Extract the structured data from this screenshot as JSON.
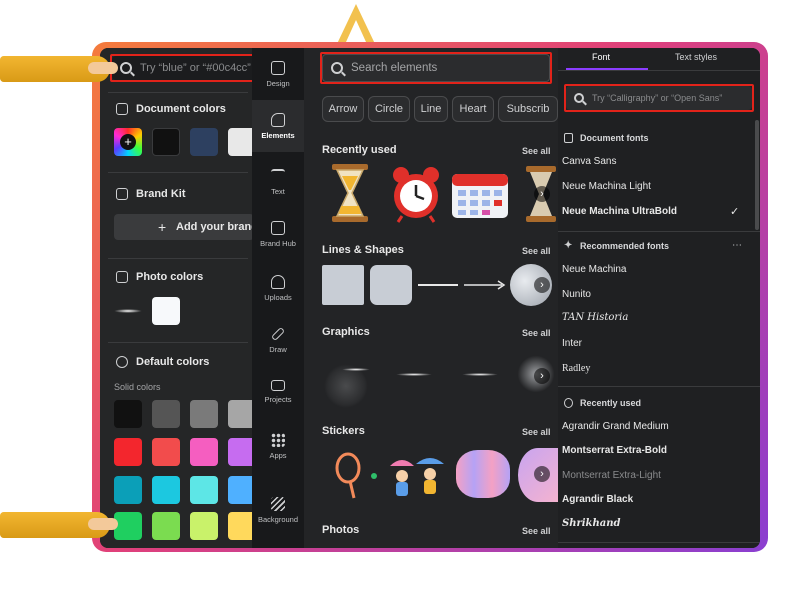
{
  "colors_panel": {
    "search_placeholder": "Try “blue” or “#00c4cc”",
    "document_colors_title": "Document colors",
    "document_swatches": [
      "#111111",
      "#2d4060",
      "#e8e8e8"
    ],
    "brand_kit_title": "Brand Kit",
    "add_brand_label": "Add your brand",
    "photo_colors_title": "Photo colors",
    "photo_swatch": "#f7f9fb",
    "default_colors_title": "Default colors",
    "solid_colors_label": "Solid colors",
    "solid_swatches": [
      [
        "#111111",
        "#555555",
        "#7a7a7a",
        "#a6a6a6"
      ],
      [
        "#f3262d",
        "#f24c4c",
        "#f55ec0",
        "#c66cf0"
      ],
      [
        "#0b9fb8",
        "#1cc8e0",
        "#5de6e6",
        "#4fb0ff"
      ],
      [
        "#1fcf60",
        "#7bdc50",
        "#c9f26a",
        "#ffd95c"
      ]
    ]
  },
  "rail": {
    "items": [
      {
        "label": "Design",
        "icon": "layout-icon"
      },
      {
        "label": "Elements",
        "icon": "shapes-icon",
        "active": true
      },
      {
        "label": "Text",
        "icon": "text-icon"
      },
      {
        "label": "Brand Hub",
        "icon": "briefcase-icon"
      },
      {
        "label": "Uploads",
        "icon": "cloud-upload-icon"
      },
      {
        "label": "Draw",
        "icon": "pen-icon"
      },
      {
        "label": "Projects",
        "icon": "folder-icon"
      },
      {
        "label": "Apps",
        "icon": "grid-icon"
      },
      {
        "label": "Background",
        "icon": "hatch-icon"
      }
    ]
  },
  "elements": {
    "search_placeholder": "Search elements",
    "chips": [
      "Arrow",
      "Circle",
      "Line",
      "Heart",
      "Subscrib"
    ],
    "see_all": "See all",
    "recently_used_title": "Recently used",
    "lines_shapes_title": "Lines & Shapes",
    "graphics_title": "Graphics",
    "stickers_title": "Stickers",
    "photos_title": "Photos"
  },
  "fonts": {
    "tab_font": "Font",
    "tab_text_styles": "Text styles",
    "search_placeholder": "Try “Calligraphy” or “Open Sans”",
    "document_fonts_title": "Document fonts",
    "document_fonts": [
      "Canva Sans",
      "Neue Machina Light",
      "Neue Machina UltraBold"
    ],
    "check": "✓",
    "recommended_title": "Recommended fonts",
    "more": "⋯",
    "recommended_fonts": [
      "Neue Machina",
      "Nunito",
      "TAN Historia",
      "Inter",
      "Radley"
    ],
    "recently_used_title": "Recently used",
    "recent_fonts": [
      "Agrandir Grand Medium",
      "Montserrat Extra-Bold",
      "Montserrat Extra-Light",
      "Agrandir Black",
      "Shrikhand"
    ]
  }
}
